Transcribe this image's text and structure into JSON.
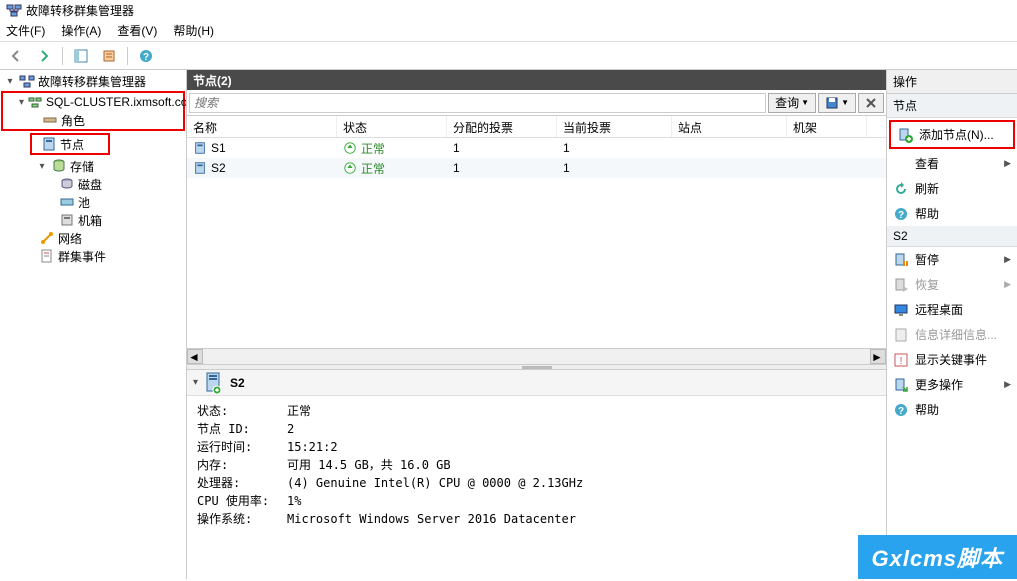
{
  "window": {
    "title": "故障转移群集管理器"
  },
  "menu": {
    "file": "文件(F)",
    "action": "操作(A)",
    "view": "查看(V)",
    "help": "帮助(H)"
  },
  "tree": {
    "root": "故障转移群集管理器",
    "cluster": "SQL-CLUSTER.ixmsoft.com",
    "roles": "角色",
    "nodes": "节点",
    "storage": "存储",
    "disks": "磁盘",
    "pools": "池",
    "enclosures": "机箱",
    "networks": "网络",
    "events": "群集事件"
  },
  "header": {
    "title": "节点(2)"
  },
  "search": {
    "placeholder": "搜索",
    "queryBtn": "查询"
  },
  "columns": {
    "name": "名称",
    "status": "状态",
    "assignedVote": "分配的投票",
    "currentVote": "当前投票",
    "site": "站点",
    "rack": "机架"
  },
  "rows": [
    {
      "name": "S1",
      "status": "正常",
      "assignedVote": "1",
      "currentVote": "1",
      "site": "",
      "rack": ""
    },
    {
      "name": "S2",
      "status": "正常",
      "assignedVote": "1",
      "currentVote": "1",
      "site": "",
      "rack": ""
    }
  ],
  "detail": {
    "node": "S2",
    "fields": {
      "statusLabel": "状态:",
      "statusValue": "正常",
      "nodeIdLabel": "节点 ID:",
      "nodeIdValue": "2",
      "uptimeLabel": "运行时间:",
      "uptimeValue": "15:21:2",
      "memoryLabel": "内存:",
      "memoryValue": "可用 14.5 GB，共 16.0 GB",
      "cpuLabel": "处理器:",
      "cpuValue": "(4) Genuine Intel(R) CPU      @ 0000 @ 2.13GHz",
      "cpuUsageLabel": "CPU 使用率:",
      "cpuUsageValue": "1%",
      "osLabel": "操作系统:",
      "osValue": "Microsoft Windows Server 2016 Datacenter"
    }
  },
  "actions": {
    "title": "操作",
    "section1": "节点",
    "addNode": "添加节点(N)...",
    "view": "查看",
    "refresh": "刷新",
    "help1": "帮助",
    "section2": "S2",
    "pause": "暂停",
    "resume": "恢复",
    "remote": "远程桌面",
    "info": "信息详细信息...",
    "critical": "显示关键事件",
    "more": "更多操作",
    "help2": "帮助"
  },
  "watermark": "Gxlcms脚本"
}
